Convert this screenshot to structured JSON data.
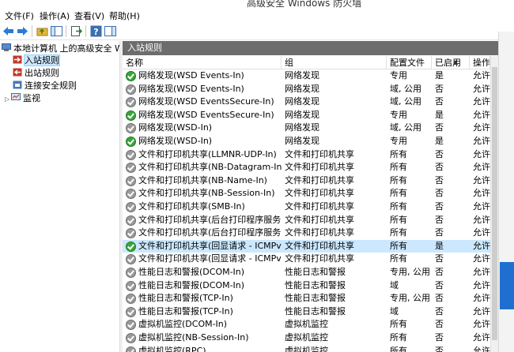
{
  "window": {
    "title": "高级安全 Windows 防火墙"
  },
  "menu": [
    {
      "label": "文件(F)"
    },
    {
      "label": "操作(A)"
    },
    {
      "label": "查看(V)"
    },
    {
      "label": "帮助(H)"
    }
  ],
  "tree": {
    "root": "本地计算机 上的高级安全 Windows 防火墙",
    "items": [
      {
        "label": "入站规则",
        "selected": true
      },
      {
        "label": "出站规则",
        "selected": false
      },
      {
        "label": "连接安全规则",
        "selected": false
      },
      {
        "label": "监视",
        "selected": false
      }
    ]
  },
  "pane": {
    "title": "入站规则"
  },
  "columns": [
    {
      "label": "名称"
    },
    {
      "label": "组"
    },
    {
      "label": "配置文件"
    },
    {
      "label": "已启用"
    },
    {
      "label": "操作"
    }
  ],
  "rows": [
    {
      "name": "网络发现(WSD Events-In)",
      "group": "网络发现",
      "profile": "专用",
      "enabled": "是",
      "action": "允许",
      "active": true
    },
    {
      "name": "网络发现(WSD Events-In)",
      "group": "网络发现",
      "profile": "域, 公用",
      "enabled": "否",
      "action": "允许",
      "active": false
    },
    {
      "name": "网络发现(WSD EventsSecure-In)",
      "group": "网络发现",
      "profile": "域, 公用",
      "enabled": "否",
      "action": "允许",
      "active": false
    },
    {
      "name": "网络发现(WSD EventsSecure-In)",
      "group": "网络发现",
      "profile": "专用",
      "enabled": "是",
      "action": "允许",
      "active": true
    },
    {
      "name": "网络发现(WSD-In)",
      "group": "网络发现",
      "profile": "域, 公用",
      "enabled": "否",
      "action": "允许",
      "active": false
    },
    {
      "name": "网络发现(WSD-In)",
      "group": "网络发现",
      "profile": "专用",
      "enabled": "是",
      "action": "允许",
      "active": true
    },
    {
      "name": "文件和打印机共享(LLMNR-UDP-In)",
      "group": "文件和打印机共享",
      "profile": "所有",
      "enabled": "否",
      "action": "允许",
      "active": false
    },
    {
      "name": "文件和打印机共享(NB-Datagram-In)",
      "group": "文件和打印机共享",
      "profile": "所有",
      "enabled": "否",
      "action": "允许",
      "active": false
    },
    {
      "name": "文件和打印机共享(NB-Name-In)",
      "group": "文件和打印机共享",
      "profile": "所有",
      "enabled": "否",
      "action": "允许",
      "active": false
    },
    {
      "name": "文件和打印机共享(NB-Session-In)",
      "group": "文件和打印机共享",
      "profile": "所有",
      "enabled": "否",
      "action": "允许",
      "active": false
    },
    {
      "name": "文件和打印机共享(SMB-In)",
      "group": "文件和打印机共享",
      "profile": "所有",
      "enabled": "否",
      "action": "允许",
      "active": false
    },
    {
      "name": "文件和打印机共享(后台打印程序服务 - R...",
      "group": "文件和打印机共享",
      "profile": "所有",
      "enabled": "否",
      "action": "允许",
      "active": false
    },
    {
      "name": "文件和打印机共享(后台打印程序服务 - R...",
      "group": "文件和打印机共享",
      "profile": "所有",
      "enabled": "否",
      "action": "允许",
      "active": false
    },
    {
      "name": "文件和打印机共享(回显请求 - ICMPv4-In)",
      "group": "文件和打印机共享",
      "profile": "所有",
      "enabled": "是",
      "action": "允许",
      "active": true,
      "selected": true
    },
    {
      "name": "文件和打印机共享(回显请求 - ICMPv6-In)",
      "group": "文件和打印机共享",
      "profile": "所有",
      "enabled": "否",
      "action": "允许",
      "active": false
    },
    {
      "name": "性能日志和警报(DCOM-In)",
      "group": "性能日志和警报",
      "profile": "专用, 公用",
      "enabled": "否",
      "action": "允许",
      "active": false
    },
    {
      "name": "性能日志和警报(DCOM-In)",
      "group": "性能日志和警报",
      "profile": "域",
      "enabled": "否",
      "action": "允许",
      "active": false
    },
    {
      "name": "性能日志和警报(TCP-In)",
      "group": "性能日志和警报",
      "profile": "专用, 公用",
      "enabled": "否",
      "action": "允许",
      "active": false
    },
    {
      "name": "性能日志和警报(TCP-In)",
      "group": "性能日志和警报",
      "profile": "域",
      "enabled": "否",
      "action": "允许",
      "active": false
    },
    {
      "name": "虚拟机监控(DCOM-In)",
      "group": "虚拟机监控",
      "profile": "所有",
      "enabled": "否",
      "action": "允许",
      "active": false
    },
    {
      "name": "虚拟机监控(NB-Session-In)",
      "group": "虚拟机监控",
      "profile": "所有",
      "enabled": "否",
      "action": "允许",
      "active": false
    },
    {
      "name": "虚拟机监控(RPC)",
      "group": "虚拟机监控",
      "profile": "所有",
      "enabled": "否",
      "action": "允许",
      "active": false
    }
  ],
  "colors": {
    "selection": "#cce8ff",
    "header": "#6d6d6d",
    "enabled_icon": "#3aa53a",
    "disabled_icon": "#9a9a9a",
    "accent": "#1e6fd0"
  },
  "icons": {
    "back": "back-arrow-icon",
    "forward": "forward-arrow-icon",
    "status_enabled": "check-circle-icon"
  }
}
